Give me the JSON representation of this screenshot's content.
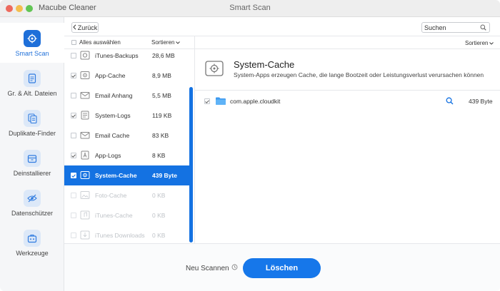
{
  "window": {
    "app_name": "Macube Cleaner",
    "title": "Smart Scan"
  },
  "sidebar": {
    "items": [
      {
        "label": "Smart Scan",
        "icon": "target-icon",
        "active": true
      },
      {
        "label": "Gr. & Alt. Dateien",
        "icon": "document-icon",
        "active": false
      },
      {
        "label": "Duplikate-Finder",
        "icon": "duplicate-icon",
        "active": false
      },
      {
        "label": "Deinstallierer",
        "icon": "box-icon",
        "active": false
      },
      {
        "label": "Datenschützer",
        "icon": "eye-slash-icon",
        "active": false
      },
      {
        "label": "Werkzeuge",
        "icon": "toolbox-icon",
        "active": false
      }
    ]
  },
  "toolbar": {
    "back_label": "Zurück",
    "search_placeholder": "Suchen"
  },
  "list": {
    "select_all_label": "Alles auswählen",
    "sort_label": "Sortieren",
    "rows": [
      {
        "name": "iTunes-Backups",
        "size": "28,6 MB",
        "checked": false,
        "selected": false,
        "dim": false,
        "icon": "backup-icon"
      },
      {
        "name": "App-Cache",
        "size": "8,9 MB",
        "checked": true,
        "selected": false,
        "dim": false,
        "icon": "app-cache-icon"
      },
      {
        "name": "Email Anhang",
        "size": "5,5 MB",
        "checked": false,
        "selected": false,
        "dim": false,
        "icon": "mail-icon"
      },
      {
        "name": "System-Logs",
        "size": "119 KB",
        "checked": true,
        "selected": false,
        "dim": false,
        "icon": "log-icon"
      },
      {
        "name": "Email Cache",
        "size": "83 KB",
        "checked": false,
        "selected": false,
        "dim": false,
        "icon": "mail-icon"
      },
      {
        "name": "App-Logs",
        "size": "8 KB",
        "checked": true,
        "selected": false,
        "dim": false,
        "icon": "app-log-icon"
      },
      {
        "name": "System-Cache",
        "size": "439 Byte",
        "checked": true,
        "selected": true,
        "dim": false,
        "icon": "system-cache-icon"
      },
      {
        "name": "Foto-Cache",
        "size": "0 KB",
        "checked": false,
        "selected": false,
        "dim": true,
        "icon": "photo-icon"
      },
      {
        "name": "iTunes-Cache",
        "size": "0 KB",
        "checked": false,
        "selected": false,
        "dim": true,
        "icon": "music-icon"
      },
      {
        "name": "iTunes Downloads",
        "size": "0 KB",
        "checked": false,
        "selected": false,
        "dim": true,
        "icon": "download-icon"
      }
    ]
  },
  "detail": {
    "sort_label": "Sortieren",
    "title": "System-Cache",
    "description": "System-Apps erzeugen Cache, die lange Bootzeit oder Leistungsverlust verursachen können",
    "files": [
      {
        "name": "com.apple.cloudkit",
        "size": "439 Byte",
        "checked": true
      }
    ]
  },
  "footer": {
    "rescan_label": "Neu Scannen",
    "delete_label": "Löschen"
  },
  "colors": {
    "accent": "#1472e2",
    "sidebar_bg": "#f5f6f8"
  }
}
